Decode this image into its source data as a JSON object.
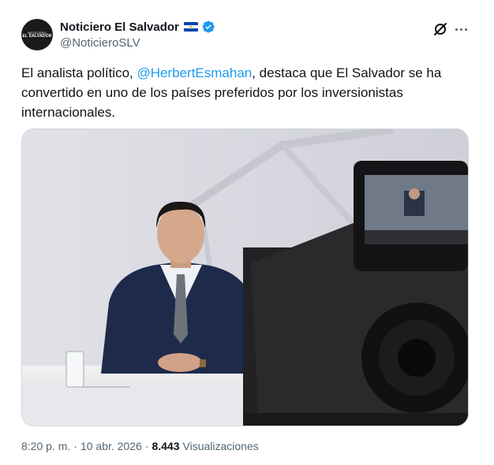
{
  "tweet": {
    "author": {
      "display_name": "Noticiero El Salvador",
      "handle": "@NoticieroSLV",
      "avatar_text_top": "NOTICIERO",
      "avatar_text_bottom": "EL SALVADOR",
      "verified": true,
      "flag": "El Salvador flag"
    },
    "text_before": "El analista político, ",
    "mention": "@HerbertEsmahan",
    "text_after": ", destaca que El Salvador se ha convertido en uno de los países preferidos por los inversionistas internacionales.",
    "media": {
      "description_icon": "photo-anchor-news-desk"
    },
    "time": "8:20 p. m.",
    "separator": "·",
    "date": "10 abr. 2026",
    "views_count": "8.443",
    "views_label": "Visualizaciones"
  },
  "colors": {
    "link": "#1d9bf0",
    "verified": "#1d9bf0",
    "secondary_text": "#536471",
    "primary_text": "#0f1419"
  },
  "icons": {
    "grok": "grok-icon",
    "more": "more-icon",
    "verified": "verified-badge-icon"
  }
}
